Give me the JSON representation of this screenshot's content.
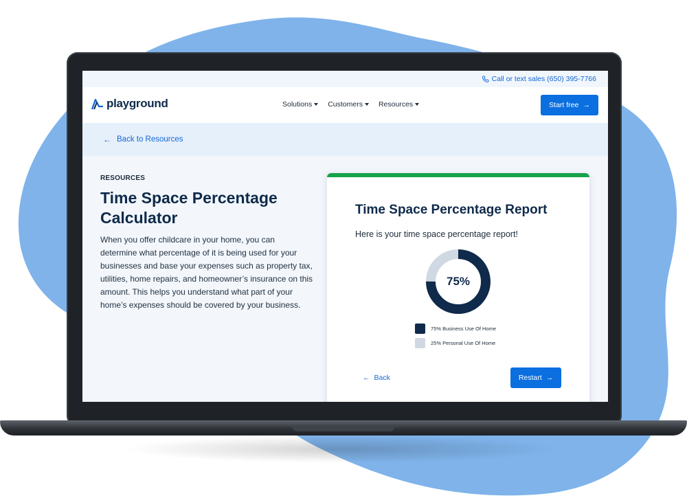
{
  "topbar": {
    "phone_text": "Call or text sales (650) 395-7766",
    "icon": "phone-icon"
  },
  "nav": {
    "logo_text": "playground",
    "logo_icon": "slide-icon",
    "menu": [
      {
        "label": "Solutions"
      },
      {
        "label": "Customers"
      },
      {
        "label": "Resources"
      }
    ],
    "cta_label": "Start free"
  },
  "backbar": {
    "label": "Back to Resources"
  },
  "article": {
    "eyebrow": "RESOURCES",
    "title": "Time Space Percentage Calculator",
    "description": "When you offer childcare in your home, you can determine what percentage of it is being used for your businesses and base your expenses such as property tax, utilities, home repairs, and homeowner’s insurance on this amount. This helps you understand what part of your home’s expenses should be covered by your business."
  },
  "report": {
    "title": "Time Space Percentage Report",
    "subtitle": "Here is your time space percentage report!",
    "center_label": "75%",
    "legend": [
      {
        "label": "75% Business Use Of Home",
        "color": "#0f2a4a"
      },
      {
        "label": "25% Personal Use Of Home",
        "color": "#cfd8e3"
      }
    ],
    "back_label": "Back",
    "restart_label": "Restart"
  },
  "chart_data": {
    "type": "pie",
    "categories": [
      "Business Use Of Home",
      "Personal Use Of Home"
    ],
    "values": [
      75,
      25
    ]
  },
  "colors": {
    "accent": "#0b6fe0",
    "navy": "#0f2a4a",
    "success": "#16a34a",
    "background_blob": "#7fb3ea"
  }
}
